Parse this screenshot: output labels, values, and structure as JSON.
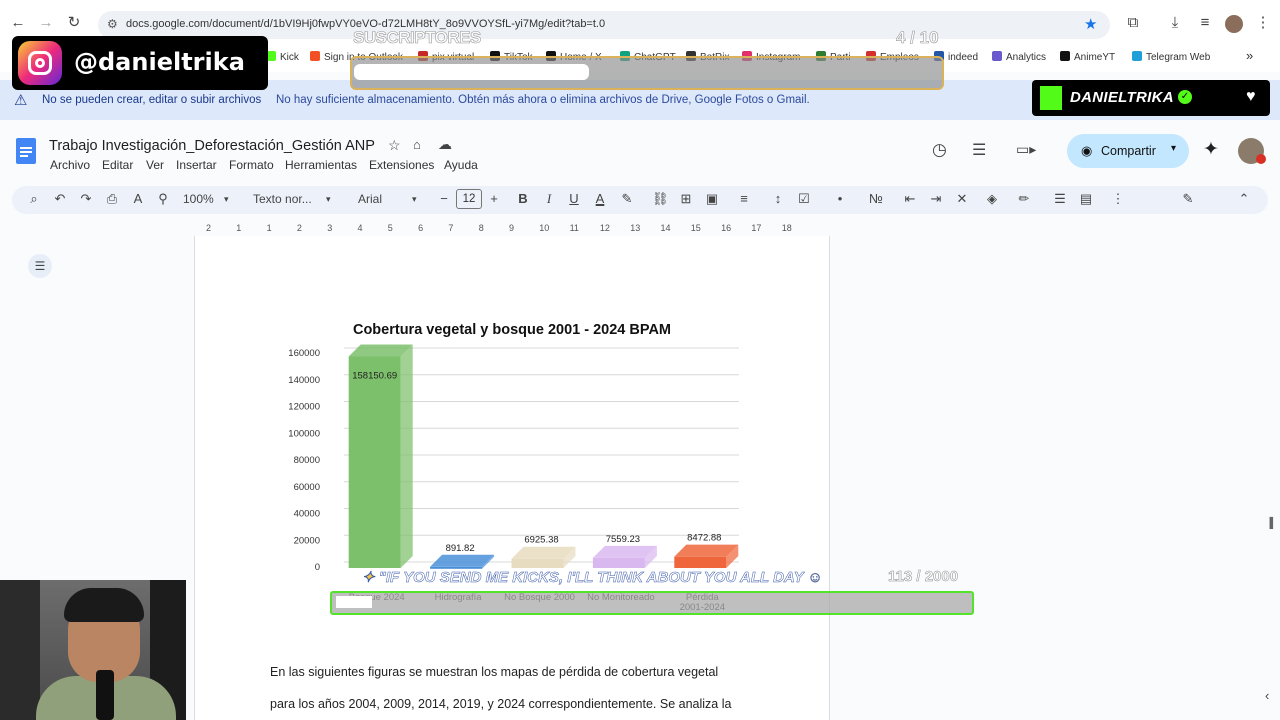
{
  "browser": {
    "url": "docs.google.com/document/d/1bVI9Hj0fwpVY0eVO-d72LMH8tY_8o9VVOYSfL-yi7Mg/edit?tab=t.0",
    "bookmarks": [
      "Kick",
      "Sign in to Outlook",
      "pix virtual",
      "TikTok",
      "Home / X",
      "ChatGPT",
      "BotRix",
      "Instagram",
      "Parti",
      "Empleos",
      "indeed",
      "Analytics",
      "AnimeYT",
      "Telegram Web"
    ],
    "colors": {
      "bookmark_icons": [
        "#53fc18",
        "#f25022",
        "#c62828",
        "#111111",
        "#111111",
        "#10a37f",
        "#333333",
        "#e1306c",
        "#2e7d32",
        "#d32f2f",
        "#2557a7",
        "#6a5acd",
        "#111111",
        "#229ed9"
      ]
    }
  },
  "warning": {
    "title": "No se pueden crear, editar o subir archivos",
    "message": "No hay suficiente almacenamiento. Obtén más ahora o elimina archivos de Drive, Google Fotos o Gmail."
  },
  "docs": {
    "title": "Trabajo Investigación_Deforestación_Gestión ANP",
    "menus": [
      "Archivo",
      "Editar",
      "Ver",
      "Insertar",
      "Formato",
      "Herramientas",
      "Extensiones",
      "Ayuda"
    ],
    "share_label": "Compartir",
    "toolbar": {
      "zoom": "100%",
      "style": "Texto nor...",
      "font": "Arial",
      "font_size": "12",
      "bold": "B",
      "italic": "I",
      "underline": "U"
    },
    "ruler_ticks": [
      "2",
      "1",
      "1",
      "2",
      "3",
      "4",
      "5",
      "6",
      "7",
      "8",
      "9",
      "10",
      "11",
      "12",
      "13",
      "14",
      "15",
      "16",
      "17",
      "18"
    ]
  },
  "body": {
    "line1": "En las siguientes figuras se muestran los mapas de pérdida de cobertura vegetal",
    "line2": "para los años 2004, 2009, 2014, 2019, y 2024 correspondientemente. Se analiza la"
  },
  "chart_data": {
    "type": "bar",
    "title": "Cobertura vegetal y bosque 2001 - 2024 BPAM",
    "categories": [
      "Bosque 2024",
      "Hidrografía",
      "No Bosque 2000",
      "No Monitoreado",
      "Pérdida 2001-2024"
    ],
    "category_lines": [
      [
        "Bosque 2024"
      ],
      [
        "Hidrografía"
      ],
      [
        "No Bosque 2000"
      ],
      [
        "No Monitoreado"
      ],
      [
        "Pérdida",
        "2001-2024"
      ]
    ],
    "values": [
      158150.69,
      891.82,
      6925.38,
      7559.23,
      8472.88
    ],
    "value_labels": [
      "158150.69",
      "891.82",
      "6925.38",
      "7559.23",
      "8472.88"
    ],
    "colors": [
      "#7dc06b",
      "#4a90d9",
      "#e8dcc0",
      "#d9b8f0",
      "#f0663c"
    ],
    "ylim": [
      0,
      160000
    ],
    "yticks": [
      0,
      20000,
      40000,
      60000,
      80000,
      100000,
      120000,
      140000,
      160000
    ],
    "xlabel": "",
    "ylabel": "",
    "grid": true,
    "style": "3d"
  },
  "overlays": {
    "instagram_handle": "@danieltrika",
    "subscribers_label": "SUSCRIPTORES",
    "subscribers_count": "4 / 10",
    "subscribers_progress": 0.4,
    "kick_name": "DANIELTRIKA",
    "kick_goal_message": "\"IF YOU SEND ME KICKS, I'LL THINK ABOUT YOU ALL DAY",
    "kick_goal_count": "113 / 2000",
    "kick_goal_progress": 0.0565
  }
}
